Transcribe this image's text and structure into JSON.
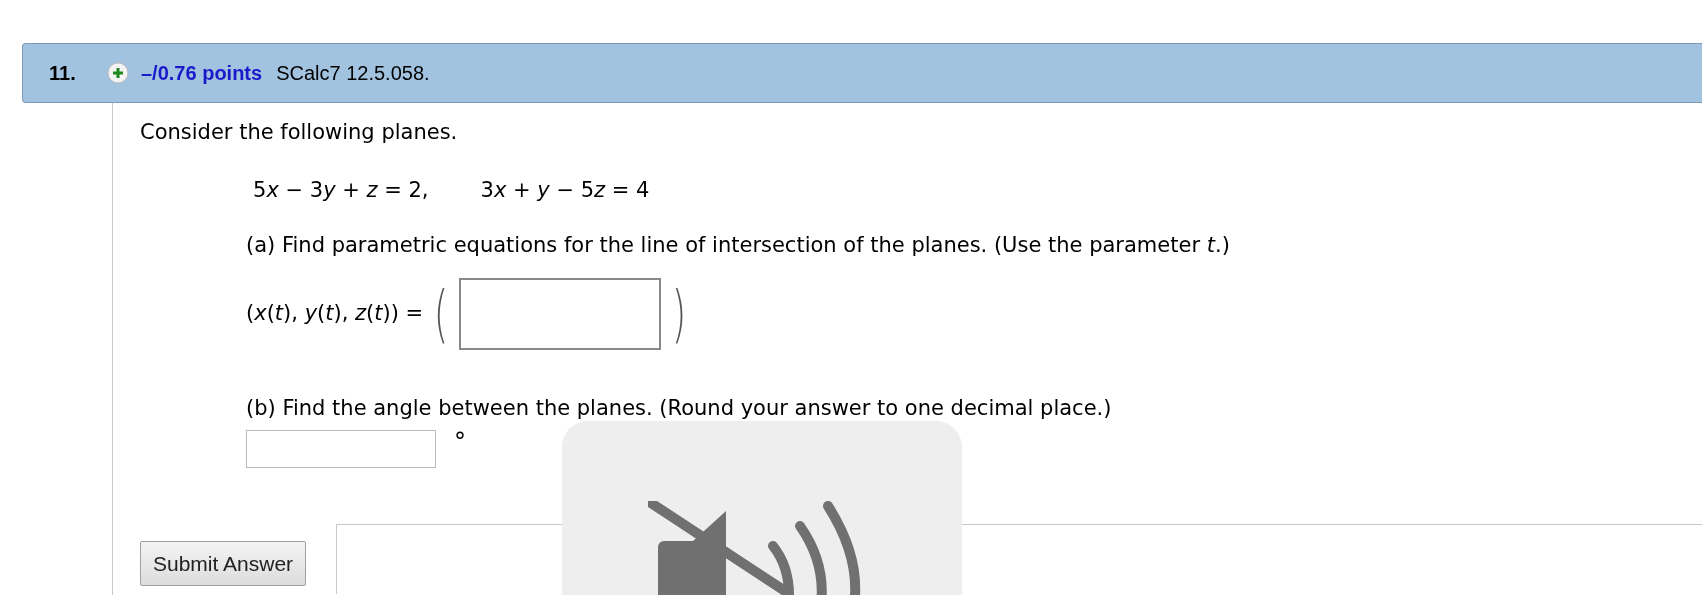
{
  "question": {
    "number": "11.",
    "points": "–/0.76 points",
    "source": "SCalc7 12.5.058."
  },
  "prompt": "Consider the following planes.",
  "equations": [
    [
      "5",
      "*x*",
      " − 3",
      "*y*",
      " + *z* = 2,"
    ],
    [
      "3",
      "*x*",
      " + *y* − 5",
      "*z*",
      " = 4"
    ]
  ],
  "parts": [
    {
      "kind": "vector",
      "text": "(a) Find parametric equations for the line of intersection of the planes. (Use the parameter *t*.)",
      "lhs": "(*x*(*t*), *y*(*t*), *z*(*t*)) =",
      "open": "(",
      "close": ")"
    },
    {
      "kind": "angle",
      "text": "(b) Find the angle between the planes. (Round your answer to one decimal place.)",
      "unit": "°"
    }
  ],
  "submit": "Submit Answer"
}
